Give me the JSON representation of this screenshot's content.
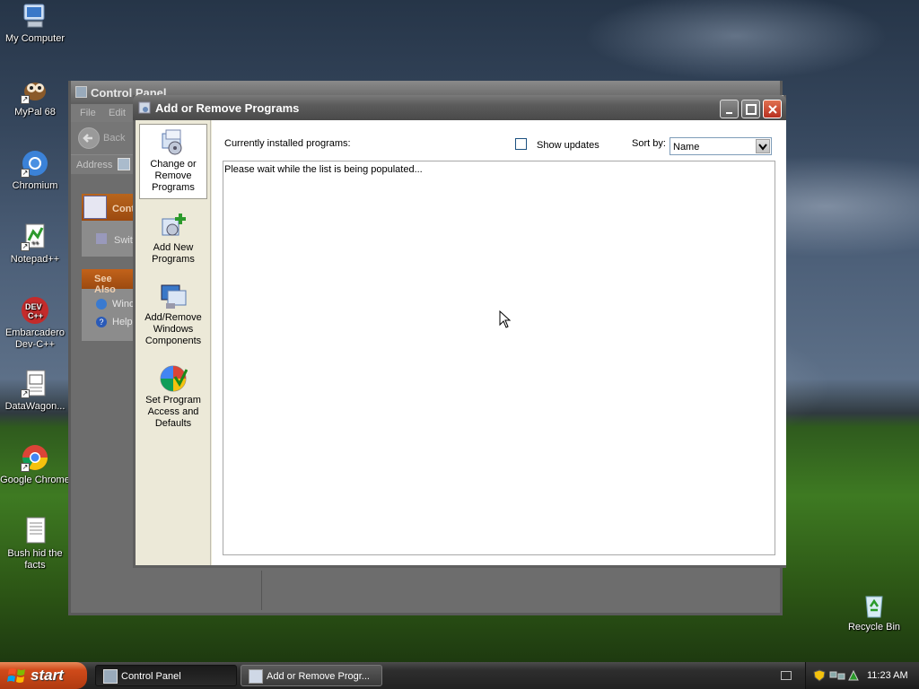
{
  "desktop": {
    "icons": [
      {
        "label": "My Computer"
      },
      {
        "label": "MyPal 68"
      },
      {
        "label": "Chromium"
      },
      {
        "label": "Notepad++"
      },
      {
        "label": "Embarcadero Dev-C++"
      },
      {
        "label": "DataWagon..."
      },
      {
        "label": "Google Chrome"
      },
      {
        "label": "Bush hid the facts"
      },
      {
        "label": "Recycle Bin"
      }
    ]
  },
  "control_panel": {
    "title": "Control Panel",
    "menu": {
      "file": "File",
      "edit": "Edit"
    },
    "back_label": "Back",
    "address_label": "Address",
    "task_header": "Cont",
    "task_item": "Swit",
    "see_also_header": "See Also",
    "see_also_links": [
      "Wind",
      "Help"
    ]
  },
  "add_remove": {
    "title": "Add or Remove Programs",
    "sidebar": [
      {
        "label": "Change or Remove Programs"
      },
      {
        "label": "Add New Programs"
      },
      {
        "label": "Add/Remove Windows Components"
      },
      {
        "label": "Set Program Access and Defaults"
      }
    ],
    "installed_label": "Currently installed programs:",
    "show_updates_label": "Show updates",
    "show_updates_checked": false,
    "sort_by_label": "Sort by:",
    "sort_by_value": "Name",
    "list_message": "Please wait while the list is being populated..."
  },
  "taskbar": {
    "start_label": "start",
    "tasks": [
      {
        "label": "Control Panel"
      },
      {
        "label": "Add or Remove Progr..."
      }
    ],
    "clock": "11:23 AM"
  }
}
